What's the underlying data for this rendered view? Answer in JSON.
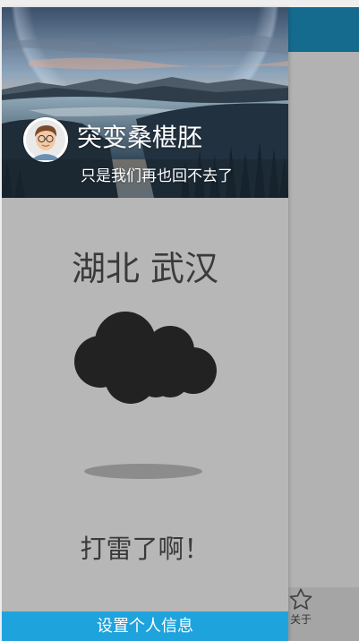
{
  "drawer": {
    "header": {
      "user_name": "突变桑椹胚",
      "signature": "只是我们再也回不去了"
    },
    "weather": {
      "city": "湖北 武汉",
      "icon": "cloud-icon",
      "description": "打雷了啊！"
    },
    "settings_button_label": "设置个人信息"
  },
  "background_app": {
    "bottom_nav": {
      "items": [
        {
          "icon": "star-icon",
          "label": "关于"
        }
      ]
    }
  },
  "colors": {
    "app_bar": "#156b8e",
    "drawer_background": "#b7b7b7",
    "settings_button": "#1fa3dd",
    "cloud": "#222222",
    "text": "#3a3a3a"
  }
}
